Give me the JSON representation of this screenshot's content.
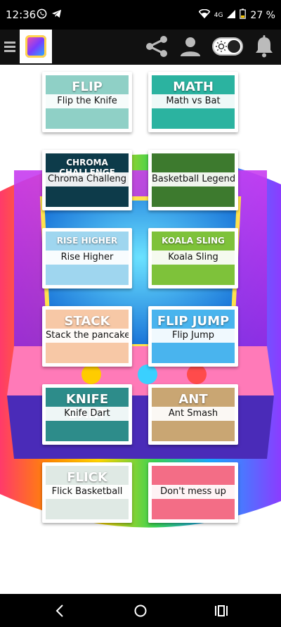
{
  "status_bar": {
    "time": "12:36",
    "network": "4G",
    "battery": "27 %",
    "icons": [
      "whatsapp-icon",
      "telegram-icon",
      "wifi-icon",
      "signal-icon",
      "battery-icon"
    ]
  },
  "app_bar": {
    "icons": [
      "menu-icon",
      "app-logo",
      "share-icon",
      "profile-icon",
      "toggle-icon",
      "notification-bell-icon"
    ]
  },
  "games": [
    {
      "title": "Flip the Knife",
      "thumb_text": "FLIP",
      "thumb_color": "#8fd0c6"
    },
    {
      "title": "Math vs Bat",
      "thumb_text": "MATH",
      "thumb_color": "#2bb3a0"
    },
    {
      "title": "Chroma Challeng",
      "thumb_text": "CHROMA CHALLENGE",
      "thumb_color": "#0d3b4a"
    },
    {
      "title": "Basketball Legend",
      "thumb_text": "",
      "thumb_color": "#3d7a2e"
    },
    {
      "title": "Rise Higher",
      "thumb_text": "RISE HIGHER",
      "thumb_color": "#9fd6ef"
    },
    {
      "title": "Koala Sling",
      "thumb_text": "KOALA SLING",
      "thumb_color": "#7ec23a"
    },
    {
      "title": "Stack the pancake",
      "thumb_text": "STACK",
      "thumb_color": "#f7c8a6"
    },
    {
      "title": "Flip Jump",
      "thumb_text": "FLIP JUMP",
      "thumb_color": "#49b4ee"
    },
    {
      "title": "Knife Dart",
      "thumb_text": "KNIFE DART",
      "thumb_color": "#2d8c8a"
    },
    {
      "title": "Ant Smash",
      "thumb_text": "ANT",
      "thumb_color": "#c9a673"
    },
    {
      "title": "Flick Basketball",
      "thumb_text": "FLICK",
      "thumb_color": "#dfe9e4"
    },
    {
      "title": "Don't mess up",
      "thumb_text": "",
      "thumb_color": "#f36d86"
    }
  ],
  "nav_bar": {
    "icons": [
      "back-icon",
      "home-icon",
      "recents-icon"
    ]
  }
}
